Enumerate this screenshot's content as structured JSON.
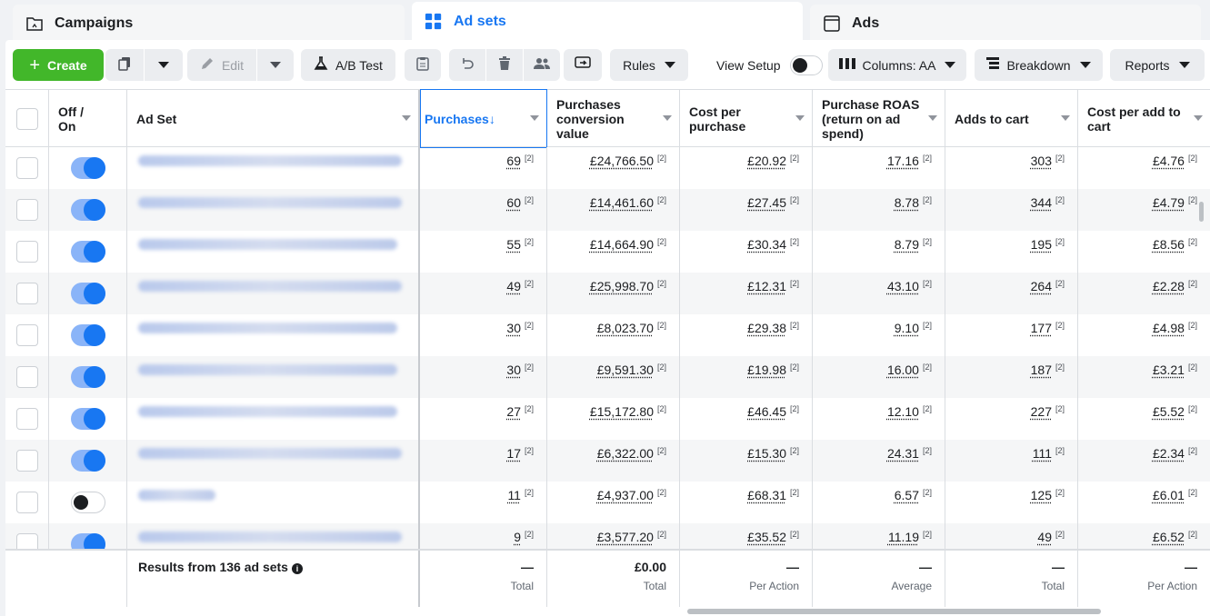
{
  "tabs": [
    {
      "label": "Campaigns",
      "icon": "folder-icon"
    },
    {
      "label": "Ad sets",
      "icon": "grid-icon"
    },
    {
      "label": "Ads",
      "icon": "window-icon"
    }
  ],
  "toolbar": {
    "create_label": "Create",
    "edit_label": "Edit",
    "ab_test_label": "A/B Test",
    "rules_label": "Rules",
    "view_setup_label": "View Setup",
    "columns_label": "Columns: AA",
    "breakdown_label": "Breakdown",
    "reports_label": "Reports"
  },
  "table": {
    "headers": {
      "off_on": "Off / On",
      "ad_set": "Ad Set",
      "purchases": "Purchases↓",
      "conv_value": "Purchases conversion value",
      "cost_per_purchase": "Cost per purchase",
      "roas": "Purchase ROAS (return on ad spend)",
      "adds_to_cart": "Adds to cart",
      "cost_per_add": "Cost per add to cart"
    },
    "superscript": "[2]",
    "rows": [
      {
        "on": true,
        "purchases": "69",
        "conv_value": "£24,766.50",
        "cpp": "£20.92",
        "roas": "17.16",
        "adds": "303",
        "cpa": "£4.76"
      },
      {
        "on": true,
        "purchases": "60",
        "conv_value": "£14,461.60",
        "cpp": "£27.45",
        "roas": "8.78",
        "adds": "344",
        "cpa": "£4.79"
      },
      {
        "on": true,
        "purchases": "55",
        "conv_value": "£14,664.90",
        "cpp": "£30.34",
        "roas": "8.79",
        "adds": "195",
        "cpa": "£8.56"
      },
      {
        "on": true,
        "purchases": "49",
        "conv_value": "£25,998.70",
        "cpp": "£12.31",
        "roas": "43.10",
        "adds": "264",
        "cpa": "£2.28"
      },
      {
        "on": true,
        "purchases": "30",
        "conv_value": "£8,023.70",
        "cpp": "£29.38",
        "roas": "9.10",
        "adds": "177",
        "cpa": "£4.98"
      },
      {
        "on": true,
        "purchases": "30",
        "conv_value": "£9,591.30",
        "cpp": "£19.98",
        "roas": "16.00",
        "adds": "187",
        "cpa": "£3.21"
      },
      {
        "on": true,
        "purchases": "27",
        "conv_value": "£15,172.80",
        "cpp": "£46.45",
        "roas": "12.10",
        "adds": "227",
        "cpa": "£5.52"
      },
      {
        "on": true,
        "purchases": "17",
        "conv_value": "£6,322.00",
        "cpp": "£15.30",
        "roas": "24.31",
        "adds": "111",
        "cpa": "£2.34"
      },
      {
        "on": false,
        "purchases": "11",
        "conv_value": "£4,937.00",
        "cpp": "£68.31",
        "roas": "6.57",
        "adds": "125",
        "cpa": "£6.01"
      },
      {
        "on": true,
        "purchases": "9",
        "conv_value": "£3,577.20",
        "cpp": "£35.52",
        "roas": "11.19",
        "adds": "49",
        "cpa": "£6.52"
      }
    ],
    "footer": {
      "results": "Results from 136 ad sets",
      "purchases": {
        "value": "—",
        "sub": "Total"
      },
      "conv_value": {
        "value": "£0.00",
        "sub": "Total"
      },
      "cpp": {
        "value": "—",
        "sub": "Per Action"
      },
      "roas": {
        "value": "—",
        "sub": "Average"
      },
      "adds": {
        "value": "—",
        "sub": "Total"
      },
      "cpa": {
        "value": "—",
        "sub": "Per Action"
      }
    }
  },
  "colors": {
    "accent": "#1877f2",
    "create": "#42b72a"
  }
}
